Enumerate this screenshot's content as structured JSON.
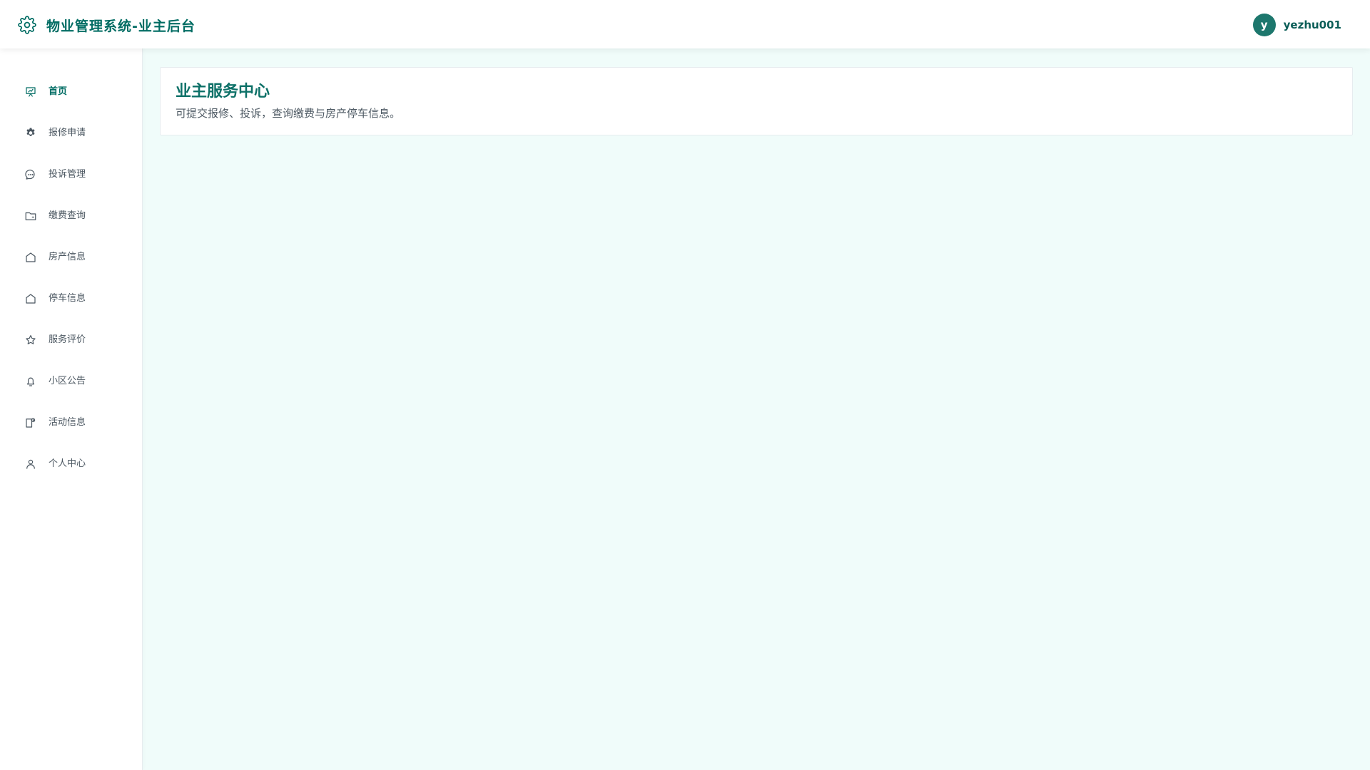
{
  "app": {
    "title": "物业管理系统-业主后台",
    "logo_icon": "gear-icon",
    "colors": {
      "brand": "#006c63",
      "background": "#f0fcfa",
      "card_title": "#0e7168",
      "avatar": "#1d776d"
    }
  },
  "header": {
    "user": {
      "avatar_initial": "y",
      "username": "yezhu001"
    }
  },
  "sidebar": {
    "items": [
      {
        "label": "首页",
        "icon": "dashboard-icon",
        "active": true
      },
      {
        "label": "报修申请",
        "icon": "gear-icon",
        "active": false
      },
      {
        "label": "投诉管理",
        "icon": "chat-bubble-icon",
        "active": false
      },
      {
        "label": "缴费查询",
        "icon": "folder-icon",
        "active": false
      },
      {
        "label": "房产信息",
        "icon": "house-icon",
        "active": false
      },
      {
        "label": "停车信息",
        "icon": "house-icon",
        "active": false
      },
      {
        "label": "服务评价",
        "icon": "star-icon",
        "active": false
      },
      {
        "label": "小区公告",
        "icon": "bell-icon",
        "active": false
      },
      {
        "label": "活动信息",
        "icon": "calendar-icon",
        "active": false
      },
      {
        "label": "个人中心",
        "icon": "user-icon",
        "active": false
      }
    ]
  },
  "main": {
    "card": {
      "title": "业主服务中心",
      "subtitle": "可提交报修、投诉，查询缴费与房产停车信息。"
    }
  }
}
